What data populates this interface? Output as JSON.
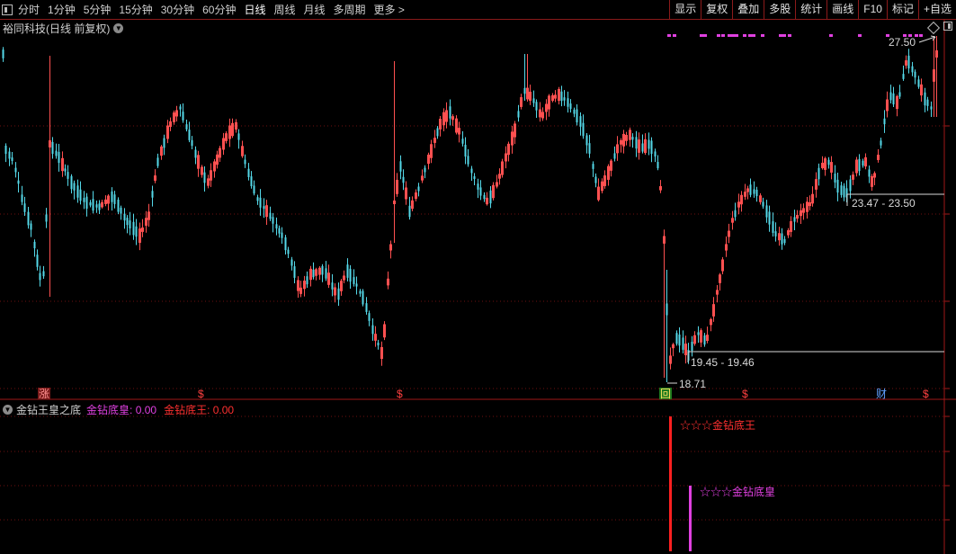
{
  "toolbar": {
    "periods": [
      "分时",
      "1分钟",
      "5分钟",
      "15分钟",
      "30分钟",
      "60分钟",
      "日线",
      "周线",
      "月线",
      "多周期",
      "更多 >"
    ],
    "active_period": "日线",
    "buttons": [
      "显示",
      "复权",
      "叠加",
      "多股",
      "统计",
      "画线",
      "F10",
      "标记",
      "+自选"
    ]
  },
  "main_panel": {
    "title": "裕同科技(日线 前复权)",
    "price_labels": {
      "high": "27.50",
      "range_upper": "23.47 - 23.50",
      "range_lower": "19.45 - 19.46",
      "low": "18.71"
    },
    "markers": {
      "zhang": "涨",
      "s": "$",
      "hui": "回",
      "cai": "财"
    }
  },
  "indicator_panel": {
    "name": "金钻王皇之底",
    "series": [
      {
        "name": "金钻底皇",
        "value": "0.00",
        "color": "#e040e0"
      },
      {
        "name": "金钻底王",
        "value": "0.00",
        "color": "#ff3030"
      }
    ],
    "annotations": [
      "☆☆☆金钻底王",
      "☆☆☆金钻底皇"
    ]
  },
  "colors": {
    "up": "#ff5050",
    "down": "#54d8e8",
    "grid": "#6e1010",
    "separator": "#a01818",
    "magenta": "#e040e0",
    "red": "#ff2020"
  }
}
